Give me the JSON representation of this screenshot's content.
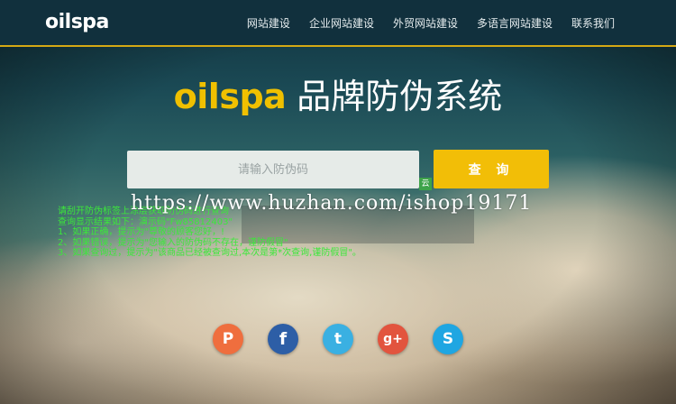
{
  "nav": {
    "brand": "oilspa",
    "links": [
      "网站建设",
      "企业网站建设",
      "外贸网站建设",
      "多语言网站建设",
      "联系我们"
    ]
  },
  "hero": {
    "brand": "oilspa",
    "subtitle": "品牌防伪系统"
  },
  "search": {
    "placeholder": "请输入防伪码",
    "button_label": "查 询"
  },
  "badge": "云",
  "instructions": {
    "line1": "请刮开防伪标签上涂层获取防伪码进行查询",
    "line2": "查询显示结果如下：演示码\"Fw85812403\"",
    "line3": "1、如果正确，提示为\"尊敬的顾客您好，!",
    "line4": "2、如果错误，提示为\"您输入的防伪码不存在，谨防假冒\"",
    "line5": "3、如果查询过，提示为\"该商品已经被查询过,本次是第*次查询,谨防假冒\"。"
  },
  "watermark": "https://www.huzhan.com/ishop19171",
  "social": [
    {
      "name": "pinterest",
      "glyph": "P",
      "color": "#ef6e3e"
    },
    {
      "name": "facebook",
      "glyph": "f",
      "color": "#2d5ea6"
    },
    {
      "name": "twitter",
      "glyph": "t",
      "color": "#3ab0e2"
    },
    {
      "name": "google-plus",
      "glyph": "g+",
      "color": "#e2543e"
    },
    {
      "name": "skype",
      "glyph": "S",
      "color": "#1fa6e2"
    }
  ]
}
